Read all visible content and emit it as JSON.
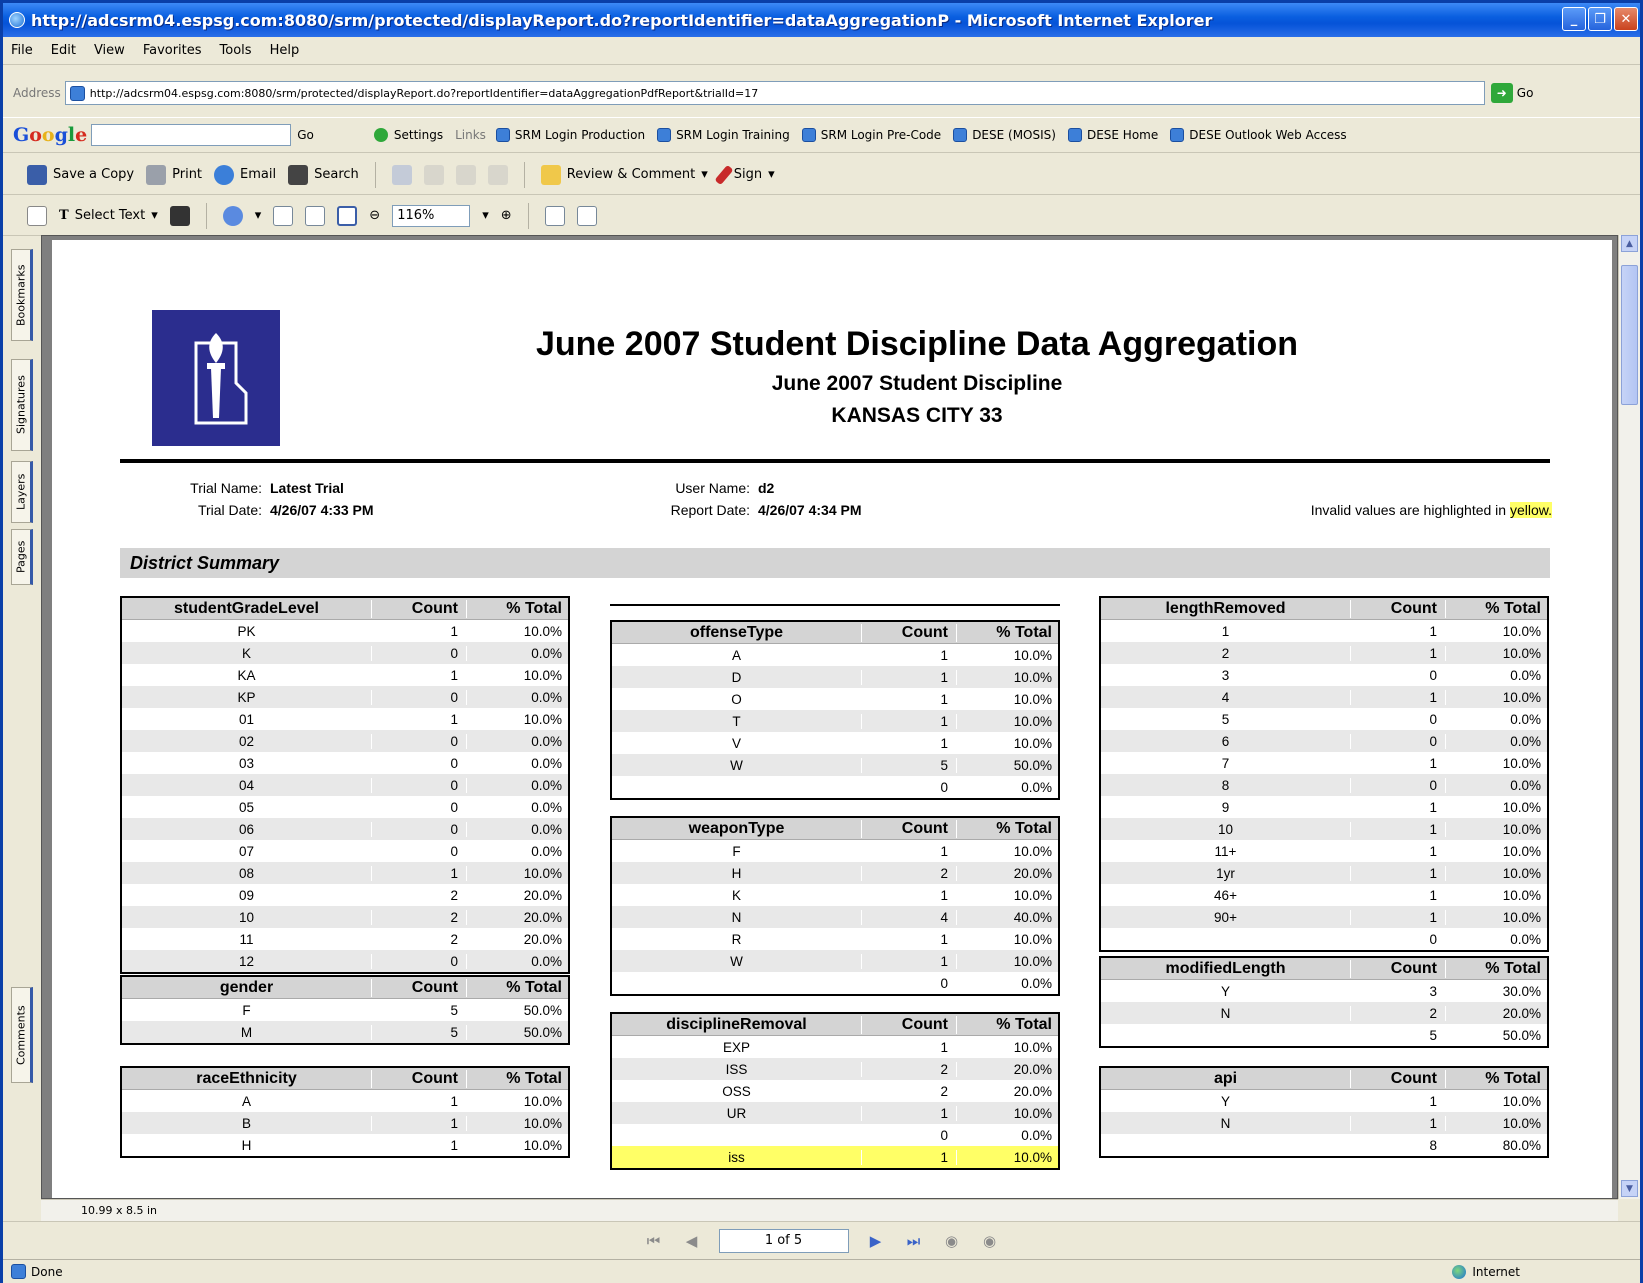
{
  "window": {
    "title": "http://adcsrm04.espsg.com:8080/srm/protected/displayReport.do?reportIdentifier=dataAggregationP - Microsoft Internet Explorer"
  },
  "menu": [
    "File",
    "Edit",
    "View",
    "Favorites",
    "Tools",
    "Help"
  ],
  "address": {
    "label": "Address",
    "url": "http://adcsrm04.espsg.com:8080/srm/protected/displayReport.do?reportIdentifier=dataAggregationPdfReport&trialId=17",
    "go": "Go"
  },
  "google_bar": {
    "go": "Go",
    "settings": "Settings",
    "links_label": "Links",
    "links": [
      "SRM Login Production",
      "SRM Login Training",
      "SRM Login Pre-Code",
      "DESE (MOSIS)",
      "DESE Home",
      "DESE Outlook Web Access"
    ]
  },
  "acrobat_toolbar1": {
    "save": "Save a Copy",
    "print": "Print",
    "email": "Email",
    "search": "Search",
    "review": "Review & Comment",
    "sign": "Sign"
  },
  "acrobat_toolbar2": {
    "select_text": "Select Text",
    "zoom": "116%"
  },
  "side_tabs": [
    "Bookmarks",
    "Signatures",
    "Layers",
    "Pages",
    "Comments"
  ],
  "page_size": "10.99 x 8.5 in",
  "page_nav": "1 of 5",
  "status": {
    "text": "Done",
    "zone": "Internet"
  },
  "report": {
    "title": "June 2007 Student Discipline Data Aggregation",
    "subtitle": "June 2007 Student Discipline",
    "district": "KANSAS CITY 33",
    "trial_name_label": "Trial Name:",
    "trial_name": "Latest Trial",
    "trial_date_label": "Trial Date:",
    "trial_date": "4/26/07 4:33 PM",
    "user_name_label": "User Name:",
    "user_name": "d2",
    "report_date_label": "Report Date:",
    "report_date": "4/26/07 4:34 PM",
    "invalid_note_prefix": "Invalid values are highlighted in",
    "invalid_note_word": "yellow.",
    "section": "District Summary",
    "count_header": "Count",
    "pct_header": "% Total",
    "tables": {
      "studentGradeLevel": {
        "name": "studentGradeLevel",
        "rows": [
          [
            "PK",
            "1",
            "10.0%"
          ],
          [
            "K",
            "0",
            "0.0%"
          ],
          [
            "KA",
            "1",
            "10.0%"
          ],
          [
            "KP",
            "0",
            "0.0%"
          ],
          [
            "01",
            "1",
            "10.0%"
          ],
          [
            "02",
            "0",
            "0.0%"
          ],
          [
            "03",
            "0",
            "0.0%"
          ],
          [
            "04",
            "0",
            "0.0%"
          ],
          [
            "05",
            "0",
            "0.0%"
          ],
          [
            "06",
            "0",
            "0.0%"
          ],
          [
            "07",
            "0",
            "0.0%"
          ],
          [
            "08",
            "1",
            "10.0%"
          ],
          [
            "09",
            "2",
            "20.0%"
          ],
          [
            "10",
            "2",
            "20.0%"
          ],
          [
            "11",
            "2",
            "20.0%"
          ],
          [
            "12",
            "0",
            "0.0%"
          ]
        ]
      },
      "gender": {
        "name": "gender",
        "rows": [
          [
            "F",
            "5",
            "50.0%"
          ],
          [
            "M",
            "5",
            "50.0%"
          ]
        ]
      },
      "raceEthnicity": {
        "name": "raceEthnicity",
        "rows": [
          [
            "A",
            "1",
            "10.0%"
          ],
          [
            "B",
            "1",
            "10.0%"
          ],
          [
            "H",
            "1",
            "10.0%"
          ]
        ]
      },
      "offenseType": {
        "name": "offenseType",
        "rows": [
          [
            "A",
            "1",
            "10.0%"
          ],
          [
            "D",
            "1",
            "10.0%"
          ],
          [
            "O",
            "1",
            "10.0%"
          ],
          [
            "T",
            "1",
            "10.0%"
          ],
          [
            "V",
            "1",
            "10.0%"
          ],
          [
            "W",
            "5",
            "50.0%"
          ],
          [
            "",
            "0",
            "0.0%"
          ]
        ]
      },
      "weaponType": {
        "name": "weaponType",
        "rows": [
          [
            "F",
            "1",
            "10.0%"
          ],
          [
            "H",
            "2",
            "20.0%"
          ],
          [
            "K",
            "1",
            "10.0%"
          ],
          [
            "N",
            "4",
            "40.0%"
          ],
          [
            "R",
            "1",
            "10.0%"
          ],
          [
            "W",
            "1",
            "10.0%"
          ],
          [
            "",
            "0",
            "0.0%"
          ]
        ]
      },
      "disciplineRemoval": {
        "name": "disciplineRemoval",
        "rows": [
          [
            "EXP",
            "1",
            "10.0%"
          ],
          [
            "ISS",
            "2",
            "20.0%"
          ],
          [
            "OSS",
            "2",
            "20.0%"
          ],
          [
            "UR",
            "1",
            "10.0%"
          ],
          [
            "",
            "0",
            "0.0%"
          ],
          [
            "iss",
            "1",
            "10.0%"
          ]
        ]
      },
      "lengthRemoved": {
        "name": "lengthRemoved",
        "rows": [
          [
            "1",
            "1",
            "10.0%"
          ],
          [
            "2",
            "1",
            "10.0%"
          ],
          [
            "3",
            "0",
            "0.0%"
          ],
          [
            "4",
            "1",
            "10.0%"
          ],
          [
            "5",
            "0",
            "0.0%"
          ],
          [
            "6",
            "0",
            "0.0%"
          ],
          [
            "7",
            "1",
            "10.0%"
          ],
          [
            "8",
            "0",
            "0.0%"
          ],
          [
            "9",
            "1",
            "10.0%"
          ],
          [
            "10",
            "1",
            "10.0%"
          ],
          [
            "11+",
            "1",
            "10.0%"
          ],
          [
            "1yr",
            "1",
            "10.0%"
          ],
          [
            "46+",
            "1",
            "10.0%"
          ],
          [
            "90+",
            "1",
            "10.0%"
          ],
          [
            "",
            "0",
            "0.0%"
          ]
        ]
      },
      "modifiedLength": {
        "name": "modifiedLength",
        "rows": [
          [
            "Y",
            "3",
            "30.0%"
          ],
          [
            "N",
            "2",
            "20.0%"
          ],
          [
            "",
            "5",
            "50.0%"
          ]
        ]
      },
      "api": {
        "name": "api",
        "rows": [
          [
            "Y",
            "1",
            "10.0%"
          ],
          [
            "N",
            "1",
            "10.0%"
          ],
          [
            "",
            "8",
            "80.0%"
          ]
        ]
      }
    }
  }
}
